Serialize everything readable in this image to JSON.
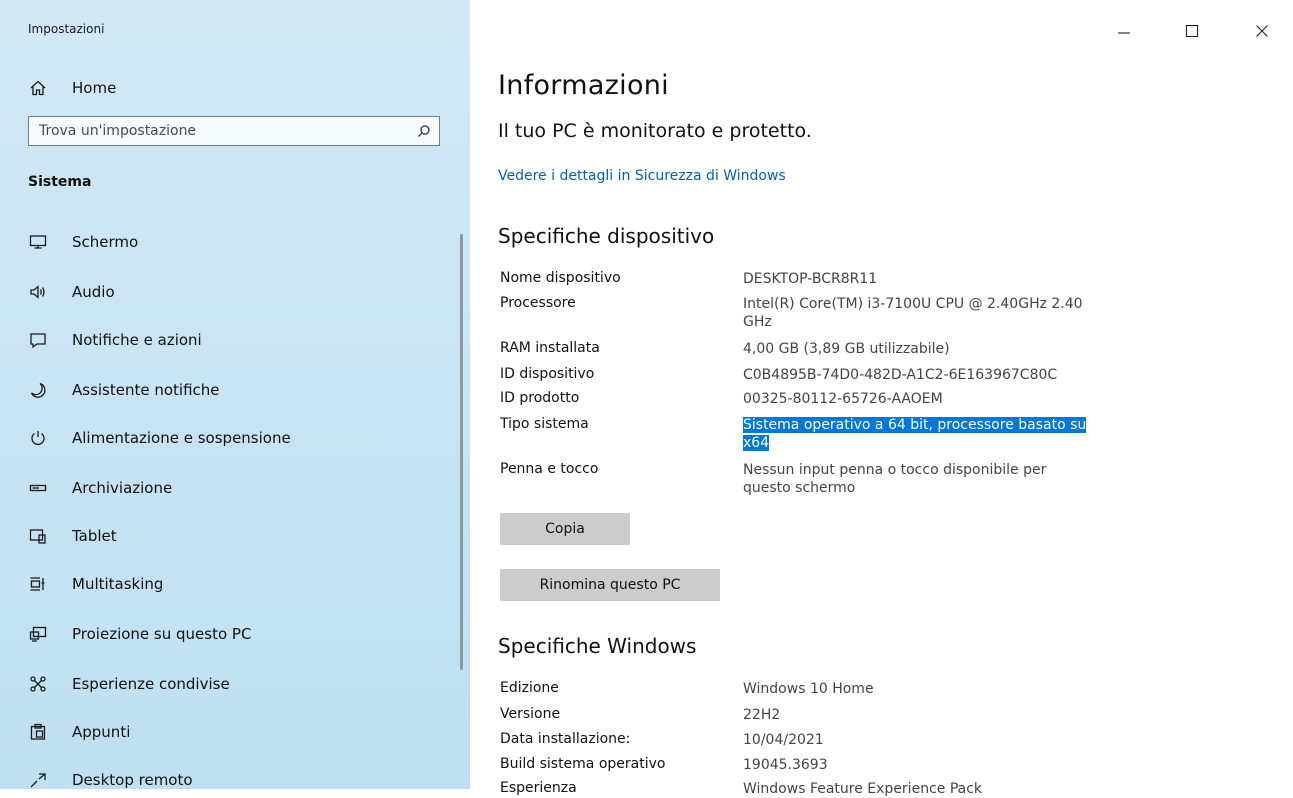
{
  "app": {
    "title": "Impostazioni"
  },
  "sidebar": {
    "home_label": "Home",
    "search_placeholder": "Trova un'impostazione",
    "section_title": "Sistema",
    "items": [
      {
        "label": "Schermo",
        "icon": "monitor-icon"
      },
      {
        "label": "Audio",
        "icon": "speaker-icon"
      },
      {
        "label": "Notifiche e azioni",
        "icon": "notification-icon"
      },
      {
        "label": "Assistente notifiche",
        "icon": "moon-icon"
      },
      {
        "label": "Alimentazione e sospensione",
        "icon": "power-icon"
      },
      {
        "label": "Archiviazione",
        "icon": "storage-icon"
      },
      {
        "label": "Tablet",
        "icon": "tablet-icon"
      },
      {
        "label": "Multitasking",
        "icon": "multitasking-icon"
      },
      {
        "label": "Proiezione su questo PC",
        "icon": "projection-icon"
      },
      {
        "label": "Esperienze condivise",
        "icon": "shared-experiences-icon"
      },
      {
        "label": "Appunti",
        "icon": "clipboard-icon"
      },
      {
        "label": "Desktop remoto",
        "icon": "remote-desktop-icon"
      }
    ]
  },
  "main": {
    "title": "Informazioni",
    "status": "Il tuo PC è monitorato e protetto.",
    "security_link": "Vedere i dettagli in Sicurezza di Windows",
    "device_specs": {
      "heading": "Specifiche dispositivo",
      "rows": [
        {
          "label": "Nome dispositivo",
          "value": "DESKTOP-BCR8R11"
        },
        {
          "label": "Processore",
          "value": "Intel(R) Core(TM) i3-7100U CPU @ 2.40GHz 2.40 GHz"
        },
        {
          "label": "RAM installata",
          "value": "4,00 GB (3,89 GB utilizzabile)"
        },
        {
          "label": "ID dispositivo",
          "value": "C0B4895B-74D0-482D-A1C2-6E163967C80C"
        },
        {
          "label": "ID prodotto",
          "value": "00325-80112-65726-AAOEM"
        },
        {
          "label": "Tipo sistema",
          "value": "Sistema operativo a 64 bit, processore basato su x64"
        },
        {
          "label": "Penna e tocco",
          "value": "Nessun input penna o tocco disponibile per questo schermo"
        }
      ],
      "copy_button": "Copia",
      "rename_button": "Rinomina questo PC"
    },
    "windows_specs": {
      "heading": "Specifiche Windows",
      "rows": [
        {
          "label": "Edizione",
          "value": "Windows 10 Home"
        },
        {
          "label": "Versione",
          "value": "22H2"
        },
        {
          "label": "Data installazione:",
          "value": "10/04/2021"
        },
        {
          "label": "Build sistema operativo",
          "value": "19045.3693"
        },
        {
          "label": "Esperienza",
          "value": "Windows Feature Experience Pack"
        }
      ]
    }
  }
}
